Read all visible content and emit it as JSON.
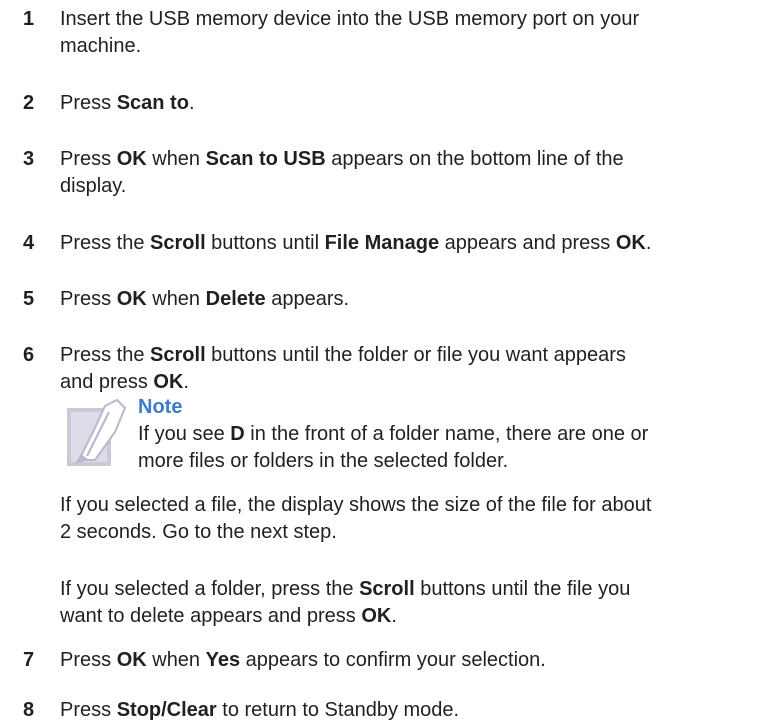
{
  "steps": [
    {
      "num": "1",
      "parts": [
        {
          "t": "Insert the USB memory device into the USB memory port on your"
        },
        {
          "br": true
        },
        {
          "t": "machine."
        }
      ]
    },
    {
      "num": "2",
      "parts": [
        {
          "t": "Press "
        },
        {
          "b": "Scan to"
        },
        {
          "t": "."
        }
      ]
    },
    {
      "num": "3",
      "parts": [
        {
          "t": "Press "
        },
        {
          "b": "OK"
        },
        {
          "t": " when "
        },
        {
          "b": "Scan to USB"
        },
        {
          "t": " appears on the bottom line of the"
        },
        {
          "br": true
        },
        {
          "t": "display."
        }
      ]
    },
    {
      "num": "4",
      "parts": [
        {
          "t": "Press the "
        },
        {
          "b": "Scroll"
        },
        {
          "t": " buttons until "
        },
        {
          "b": "File Manage"
        },
        {
          "t": " appears and press "
        },
        {
          "b": "OK"
        },
        {
          "t": "."
        }
      ]
    },
    {
      "num": "5",
      "parts": [
        {
          "t": "Press "
        },
        {
          "b": "OK"
        },
        {
          "t": " when "
        },
        {
          "b": "Delete"
        },
        {
          "t": " appears."
        }
      ]
    },
    {
      "num": "6",
      "parts": [
        {
          "t": "Press the "
        },
        {
          "b": "Scroll"
        },
        {
          "t": " buttons until the folder or file you want appears"
        },
        {
          "br": true
        },
        {
          "t": "and press "
        },
        {
          "b": "OK"
        },
        {
          "t": "."
        }
      ]
    },
    {
      "num": "7",
      "parts": [
        {
          "t": "Press "
        },
        {
          "b": "OK"
        },
        {
          "t": " when "
        },
        {
          "b": "Yes"
        },
        {
          "t": " appears to confirm your selection."
        }
      ]
    },
    {
      "num": "8",
      "parts": [
        {
          "t": "Press "
        },
        {
          "b": "Stop/Clear"
        },
        {
          "t": " to return to Standby mode."
        }
      ]
    }
  ],
  "note": {
    "title": "Note",
    "icon": "note-pen-icon",
    "title_color": "#3d7cc9",
    "parts": [
      {
        "t": "If you see "
      },
      {
        "b": "D"
      },
      {
        "t": " in the front of a folder name, there are one or"
      },
      {
        "br": true
      },
      {
        "t": "more files or folders in the selected folder."
      }
    ]
  },
  "paragraphs": [
    {
      "parts": [
        {
          "t": "If you selected a file, the display shows the size of the file for about"
        },
        {
          "br": true
        },
        {
          "t": "2 seconds. Go to the next step."
        }
      ]
    },
    {
      "parts": [
        {
          "t": "If you selected a folder, press the "
        },
        {
          "b": "Scroll"
        },
        {
          "t": " buttons until the file you"
        },
        {
          "br": true
        },
        {
          "t": "want to delete appears and press "
        },
        {
          "b": "OK"
        },
        {
          "t": "."
        }
      ]
    }
  ]
}
